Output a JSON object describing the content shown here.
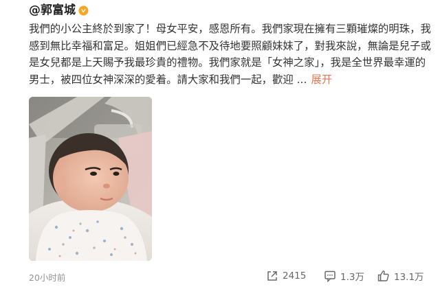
{
  "author": {
    "name": "@郭富城",
    "badge_icon": "vip-badge-icon",
    "badge_color": "#f5a623"
  },
  "post": {
    "lines": [
      "我們的小公主終於到家了！母女平安，感恩所有。我們家現在擁有三顆璀燦的明珠，我",
      "感到無比幸福和富足。姐姐們已經急不及待地要照顧妹妹了，對我來說，無論是兒子或",
      "是女兒都是上天賜予我最珍貴的禮物。我們家就是「女神之家」，我是全世界最幸運的",
      "男士，被四位女神深深的愛着。請大家和我們一起，歡迎 ..."
    ],
    "expand_label": "展开",
    "link_color": "#eb7350"
  },
  "footer": {
    "timestamp": "20小时前",
    "share_icon": "share-icon",
    "share_count": "2415",
    "comment_icon": "comment-icon",
    "comment_count": "1.3万",
    "like_icon": "thumbs-up-icon",
    "like_count": "13.1万"
  }
}
